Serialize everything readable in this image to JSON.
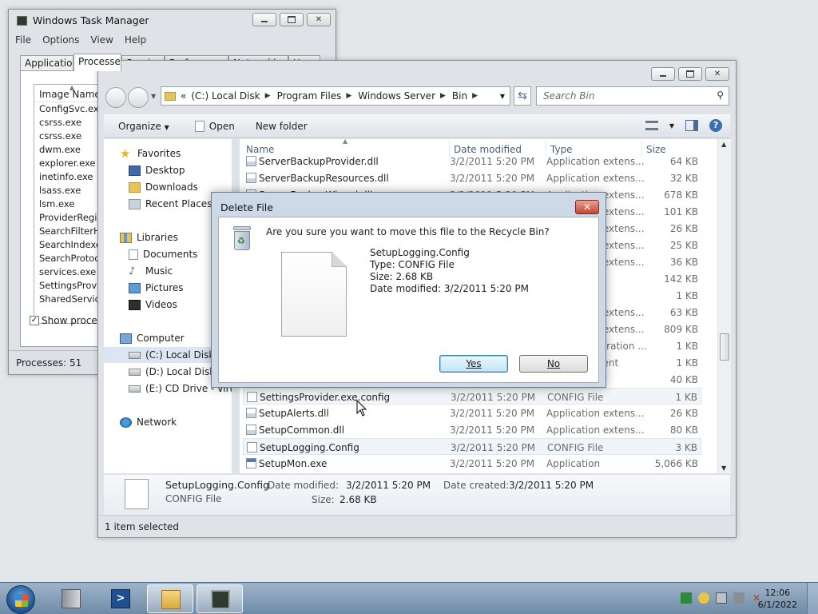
{
  "taskmgr": {
    "title": "Windows Task Manager",
    "menu": [
      "File",
      "Options",
      "View",
      "Help"
    ],
    "tabs": [
      "Applications",
      "Processes",
      "Services",
      "Performance",
      "Networking",
      "Users"
    ],
    "column_header": "Image Name",
    "processes": [
      "ConfigSvc.exe",
      "csrss.exe",
      "csrss.exe",
      "dwm.exe",
      "explorer.exe",
      "inetinfo.exe",
      "lsass.exe",
      "lsm.exe",
      "ProviderRegis...",
      "SearchFilterH...",
      "SearchIndexe...",
      "SearchProtoc...",
      "services.exe",
      "SettingsProvi...",
      "SharedServic..."
    ],
    "show_processes_label": "Show process",
    "status": "Processes: 51"
  },
  "explorer": {
    "breadcrumb": [
      "«",
      "(C:) Local Disk",
      "Program Files",
      "Windows Server",
      "Bin"
    ],
    "search_placeholder": "Search Bin",
    "toolbar": {
      "organize": "Organize",
      "open": "Open",
      "new_folder": "New folder"
    },
    "nav": {
      "favorites": "Favorites",
      "desktop": "Desktop",
      "downloads": "Downloads",
      "recent": "Recent Places",
      "libraries": "Libraries",
      "documents": "Documents",
      "music": "Music",
      "pictures": "Pictures",
      "videos": "Videos",
      "computer": "Computer",
      "c_drive": "(C:) Local Disk",
      "d_drive": "(D:) Local Disk",
      "e_drive": "(E:) CD Drive - virtio",
      "network": "Network"
    },
    "columns": {
      "name": "Name",
      "date": "Date modified",
      "type": "Type",
      "size": "Size"
    },
    "files": [
      {
        "name": "ServerBackupProvider.dll",
        "date": "3/2/2011 5:20 PM",
        "type": "Application extens...",
        "size": "64 KB",
        "icon": "dll"
      },
      {
        "name": "ServerBackupResources.dll",
        "date": "3/2/2011 5:20 PM",
        "type": "Application extens...",
        "size": "32 KB",
        "icon": "dll"
      },
      {
        "name": "ServerBackupWizard.dll",
        "date": "3/2/2011 5:20 PM",
        "type": "Application extens...",
        "size": "678 KB",
        "icon": "dll"
      },
      {
        "name": "",
        "date": "",
        "type": "Application extens...",
        "size": "101 KB",
        "icon": "dll"
      },
      {
        "name": "",
        "date": "",
        "type": "Application extens...",
        "size": "26 KB",
        "icon": "dll"
      },
      {
        "name": "",
        "date": "",
        "type": "Application extens...",
        "size": "25 KB",
        "icon": "dll"
      },
      {
        "name": "",
        "date": "",
        "type": "Application extens...",
        "size": "36 KB",
        "icon": "dll"
      },
      {
        "name": "",
        "date": "",
        "type": "",
        "size": "142 KB",
        "icon": "dll"
      },
      {
        "name": "",
        "date": "",
        "type": "",
        "size": "1 KB",
        "icon": "dll"
      },
      {
        "name": "",
        "date": "",
        "type": "Application extens...",
        "size": "63 KB",
        "icon": "dll"
      },
      {
        "name": "",
        "date": "",
        "type": "Application extens...",
        "size": "809 KB",
        "icon": "dll"
      },
      {
        "name": "",
        "date": "",
        "type": "XML Configuration ...",
        "size": "1 KB",
        "icon": "doc"
      },
      {
        "name": "",
        "date": "",
        "type": "Text Document",
        "size": "1 KB",
        "icon": "doc"
      },
      {
        "name": "",
        "date": "",
        "type": "",
        "size": "40 KB",
        "icon": "dll"
      },
      {
        "name": "SettingsProvider.exe.config",
        "date": "3/2/2011 5:20 PM",
        "type": "CONFIG File",
        "size": "1 KB",
        "icon": "doc"
      },
      {
        "name": "SetupAlerts.dll",
        "date": "3/2/2011 5:20 PM",
        "type": "Application extens...",
        "size": "26 KB",
        "icon": "dll"
      },
      {
        "name": "SetupCommon.dll",
        "date": "3/2/2011 5:20 PM",
        "type": "Application extens...",
        "size": "80 KB",
        "icon": "dll"
      },
      {
        "name": "SetupLogging.Config",
        "date": "3/2/2011 5:20 PM",
        "type": "CONFIG File",
        "size": "3 KB",
        "icon": "doc"
      },
      {
        "name": "SetupMon.exe",
        "date": "3/2/2011 5:20 PM",
        "type": "Application",
        "size": "5,066 KB",
        "icon": "app"
      }
    ],
    "details": {
      "name": "SetupLogging.Config",
      "type": "CONFIG File",
      "modified_label": "Date modified:",
      "modified_value": "3/2/2011 5:20 PM",
      "created_label": "Date created:",
      "created_value": "3/2/2011 5:20 PM",
      "size_label": "Size:",
      "size_value": "2.68 KB"
    },
    "status": "1 item selected"
  },
  "dialog": {
    "title": "Delete File",
    "question": "Are you sure you want to move this file to the Recycle Bin?",
    "file_name": "SetupLogging.Config",
    "file_type": "Type: CONFIG File",
    "file_size": "Size: 2.68 KB",
    "file_date": "Date modified: 3/2/2011 5:20 PM",
    "yes": "Yes",
    "no": "No"
  },
  "taskbar": {
    "time": "12:06",
    "date": "6/1/2022"
  }
}
